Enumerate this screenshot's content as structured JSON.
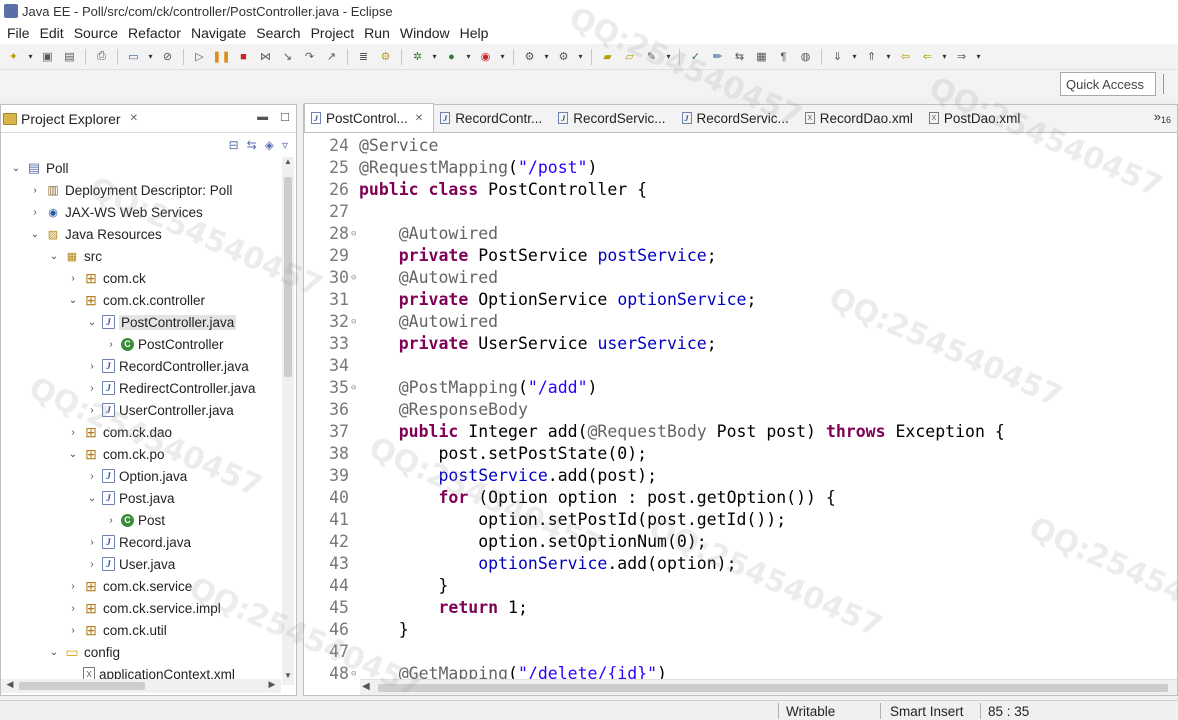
{
  "window": {
    "title": "Java EE - Poll/src/com/ck/controller/PostController.java - Eclipse"
  },
  "menu": [
    "File",
    "Edit",
    "Source",
    "Refactor",
    "Navigate",
    "Search",
    "Project",
    "Run",
    "Window",
    "Help"
  ],
  "quick_access": {
    "placeholder": "Quick Access"
  },
  "project_explorer": {
    "title": "Project Explorer",
    "tree": [
      {
        "label": "Poll",
        "depth": 0,
        "twisty": "expanded",
        "icon": "project-icon"
      },
      {
        "label": "Deployment Descriptor: Poll",
        "depth": 1,
        "twisty": "collapsed",
        "icon": "deployment-descriptor-icon"
      },
      {
        "label": "JAX-WS Web Services",
        "depth": 1,
        "twisty": "collapsed",
        "icon": "web-services-icon"
      },
      {
        "label": "Java Resources",
        "depth": 1,
        "twisty": "expanded",
        "icon": "java-resources-icon"
      },
      {
        "label": "src",
        "depth": 2,
        "twisty": "expanded",
        "icon": "source-folder-icon"
      },
      {
        "label": "com.ck",
        "depth": 3,
        "twisty": "collapsed",
        "icon": "package-icon"
      },
      {
        "label": "com.ck.controller",
        "depth": 3,
        "twisty": "expanded",
        "icon": "package-icon"
      },
      {
        "label": "PostController.java",
        "depth": 4,
        "twisty": "expanded",
        "icon": "java-file-icon",
        "selected": true
      },
      {
        "label": "PostController",
        "depth": 5,
        "twisty": "collapsed",
        "icon": "class-icon"
      },
      {
        "label": "RecordController.java",
        "depth": 4,
        "twisty": "collapsed",
        "icon": "java-file-icon"
      },
      {
        "label": "RedirectController.java",
        "depth": 4,
        "twisty": "collapsed",
        "icon": "java-file-icon"
      },
      {
        "label": "UserController.java",
        "depth": 4,
        "twisty": "collapsed",
        "icon": "java-file-icon"
      },
      {
        "label": "com.ck.dao",
        "depth": 3,
        "twisty": "collapsed",
        "icon": "package-icon"
      },
      {
        "label": "com.ck.po",
        "depth": 3,
        "twisty": "expanded",
        "icon": "package-icon"
      },
      {
        "label": "Option.java",
        "depth": 4,
        "twisty": "collapsed",
        "icon": "java-file-icon"
      },
      {
        "label": "Post.java",
        "depth": 4,
        "twisty": "expanded",
        "icon": "java-file-icon"
      },
      {
        "label": "Post",
        "depth": 5,
        "twisty": "collapsed",
        "icon": "class-icon"
      },
      {
        "label": "Record.java",
        "depth": 4,
        "twisty": "collapsed",
        "icon": "java-file-icon"
      },
      {
        "label": "User.java",
        "depth": 4,
        "twisty": "collapsed",
        "icon": "java-file-icon"
      },
      {
        "label": "com.ck.service",
        "depth": 3,
        "twisty": "collapsed",
        "icon": "package-icon"
      },
      {
        "label": "com.ck.service.impl",
        "depth": 3,
        "twisty": "collapsed",
        "icon": "package-icon"
      },
      {
        "label": "com.ck.util",
        "depth": 3,
        "twisty": "collapsed",
        "icon": "package-icon"
      },
      {
        "label": "config",
        "depth": 2,
        "twisty": "expanded",
        "icon": "folder-icon"
      },
      {
        "label": "applicationContext.xml",
        "depth": 3,
        "twisty": "none",
        "icon": "xml-file-icon"
      }
    ]
  },
  "editor": {
    "tabs": [
      {
        "label": "PostControl...",
        "icon": "java",
        "active": true,
        "closable": true
      },
      {
        "label": "RecordContr...",
        "icon": "java"
      },
      {
        "label": "RecordServic...",
        "icon": "java"
      },
      {
        "label": "RecordServic...",
        "icon": "java"
      },
      {
        "label": "RecordDao.xml",
        "icon": "xml"
      },
      {
        "label": "PostDao.xml",
        "icon": "xml"
      }
    ],
    "overflow": {
      "symbol": "»",
      "count": "16"
    },
    "lines": [
      {
        "n": "24",
        "fold": "",
        "tokens": [
          [
            "ann",
            "@Service"
          ]
        ]
      },
      {
        "n": "25",
        "fold": "",
        "tokens": [
          [
            "ann",
            "@RequestMapping"
          ],
          [
            "plain",
            "("
          ],
          [
            "str",
            "\"/post\""
          ],
          [
            "plain",
            ")"
          ]
        ]
      },
      {
        "n": "26",
        "fold": "",
        "tokens": [
          [
            "kw",
            "public"
          ],
          [
            "plain",
            " "
          ],
          [
            "kw",
            "class"
          ],
          [
            "plain",
            " PostController {"
          ]
        ]
      },
      {
        "n": "27",
        "fold": "",
        "tokens": []
      },
      {
        "n": "28",
        "fold": "⊖",
        "tokens": [
          [
            "plain",
            "    "
          ],
          [
            "ann",
            "@Autowired"
          ]
        ]
      },
      {
        "n": "29",
        "fold": "",
        "tokens": [
          [
            "plain",
            "    "
          ],
          [
            "kw",
            "private"
          ],
          [
            "plain",
            " PostService "
          ],
          [
            "fld",
            "postService"
          ],
          [
            "plain",
            ";"
          ]
        ]
      },
      {
        "n": "30",
        "fold": "⊖",
        "tokens": [
          [
            "plain",
            "    "
          ],
          [
            "ann",
            "@Autowired"
          ]
        ]
      },
      {
        "n": "31",
        "fold": "",
        "tokens": [
          [
            "plain",
            "    "
          ],
          [
            "kw",
            "private"
          ],
          [
            "plain",
            " OptionService "
          ],
          [
            "fld",
            "optionService"
          ],
          [
            "plain",
            ";"
          ]
        ]
      },
      {
        "n": "32",
        "fold": "⊖",
        "tokens": [
          [
            "plain",
            "    "
          ],
          [
            "ann",
            "@Autowired"
          ]
        ]
      },
      {
        "n": "33",
        "fold": "",
        "tokens": [
          [
            "plain",
            "    "
          ],
          [
            "kw",
            "private"
          ],
          [
            "plain",
            " UserService "
          ],
          [
            "fld",
            "userService"
          ],
          [
            "plain",
            ";"
          ]
        ]
      },
      {
        "n": "34",
        "fold": "",
        "tokens": []
      },
      {
        "n": "35",
        "fold": "⊖",
        "tokens": [
          [
            "plain",
            "    "
          ],
          [
            "ann",
            "@PostMapping"
          ],
          [
            "plain",
            "("
          ],
          [
            "str",
            "\"/add\""
          ],
          [
            "plain",
            ")"
          ]
        ]
      },
      {
        "n": "36",
        "fold": "",
        "tokens": [
          [
            "plain",
            "    "
          ],
          [
            "ann",
            "@ResponseBody"
          ]
        ]
      },
      {
        "n": "37",
        "fold": "",
        "tokens": [
          [
            "plain",
            "    "
          ],
          [
            "kw",
            "public"
          ],
          [
            "plain",
            " Integer add("
          ],
          [
            "ann",
            "@RequestBody"
          ],
          [
            "plain",
            " Post post) "
          ],
          [
            "kw",
            "throws"
          ],
          [
            "plain",
            " Exception {"
          ]
        ]
      },
      {
        "n": "38",
        "fold": "",
        "tokens": [
          [
            "plain",
            "        post.setPostState(0);"
          ]
        ]
      },
      {
        "n": "39",
        "fold": "",
        "tokens": [
          [
            "plain",
            "        "
          ],
          [
            "fld",
            "postService"
          ],
          [
            "plain",
            ".add(post);"
          ]
        ]
      },
      {
        "n": "40",
        "fold": "",
        "tokens": [
          [
            "plain",
            "        "
          ],
          [
            "kw",
            "for"
          ],
          [
            "plain",
            " (Option option : post.getOption()) {"
          ]
        ]
      },
      {
        "n": "41",
        "fold": "",
        "tokens": [
          [
            "plain",
            "            option.setPostId(post.getId());"
          ]
        ]
      },
      {
        "n": "42",
        "fold": "",
        "tokens": [
          [
            "plain",
            "            option.setOptionNum(0);"
          ]
        ]
      },
      {
        "n": "43",
        "fold": "",
        "tokens": [
          [
            "plain",
            "            "
          ],
          [
            "fld",
            "optionService"
          ],
          [
            "plain",
            ".add(option);"
          ]
        ]
      },
      {
        "n": "44",
        "fold": "",
        "tokens": [
          [
            "plain",
            "        }"
          ]
        ]
      },
      {
        "n": "45",
        "fold": "",
        "tokens": [
          [
            "plain",
            "        "
          ],
          [
            "kw",
            "return"
          ],
          [
            "plain",
            " 1;"
          ]
        ]
      },
      {
        "n": "46",
        "fold": "",
        "tokens": [
          [
            "plain",
            "    }"
          ]
        ]
      },
      {
        "n": "47",
        "fold": "",
        "tokens": []
      },
      {
        "n": "48",
        "fold": "⊖",
        "tokens": [
          [
            "plain",
            "    "
          ],
          [
            "ann",
            "@GetMapping"
          ],
          [
            "plain",
            "("
          ],
          [
            "str",
            "\"/delete/{id}\""
          ],
          [
            "plain",
            ")"
          ]
        ]
      }
    ]
  },
  "status": {
    "writable": "Writable",
    "insert_mode": "Smart Insert",
    "cursor": "85 : 35"
  },
  "colors": {
    "keyword": "#7f0055",
    "annotation": "#646464",
    "string": "#2a00ff",
    "field": "#0000c0"
  }
}
